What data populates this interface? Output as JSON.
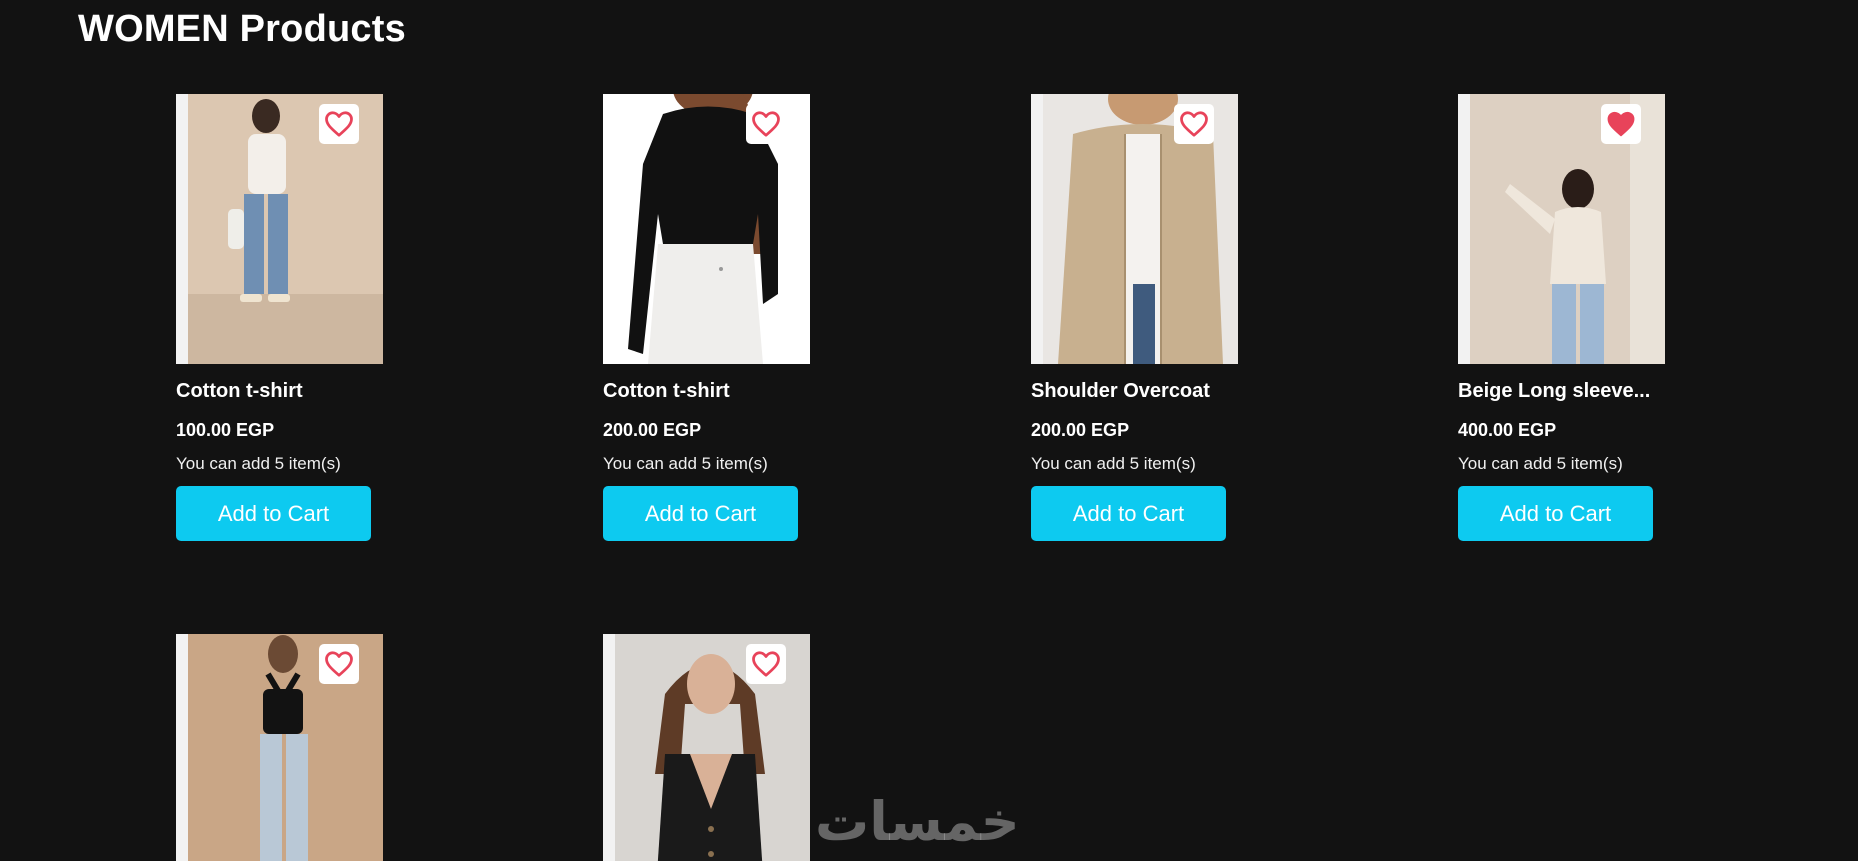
{
  "page": {
    "title": "WOMEN Products"
  },
  "colors": {
    "background": "#121212",
    "accent": "#0dcaf0",
    "heart": "#e8435a"
  },
  "products": [
    {
      "title": "Cotton t-shirt",
      "price": "100.00 EGP",
      "stock": "You can add 5 item(s)",
      "button": "Add to Cart",
      "favorited": false,
      "image": "woman-white-top-jeans"
    },
    {
      "title": "Cotton t-shirt",
      "price": "200.00 EGP",
      "stock": "You can add 5 item(s)",
      "button": "Add to Cart",
      "favorited": false,
      "image": "woman-black-top-white-jeans"
    },
    {
      "title": "Shoulder Overcoat",
      "price": "200.00 EGP",
      "stock": "You can add 5 item(s)",
      "button": "Add to Cart",
      "favorited": false,
      "image": "woman-beige-overcoat"
    },
    {
      "title": "Beige Long sleeve...",
      "price": "400.00 EGP",
      "stock": "You can add 5 item(s)",
      "button": "Add to Cart",
      "favorited": true,
      "image": "woman-beige-sweater-jeans"
    },
    {
      "image": "woman-black-halter-jeans",
      "favorited": false
    },
    {
      "image": "woman-black-vest",
      "favorited": false
    }
  ],
  "watermark": {
    "text": "خمسات"
  }
}
